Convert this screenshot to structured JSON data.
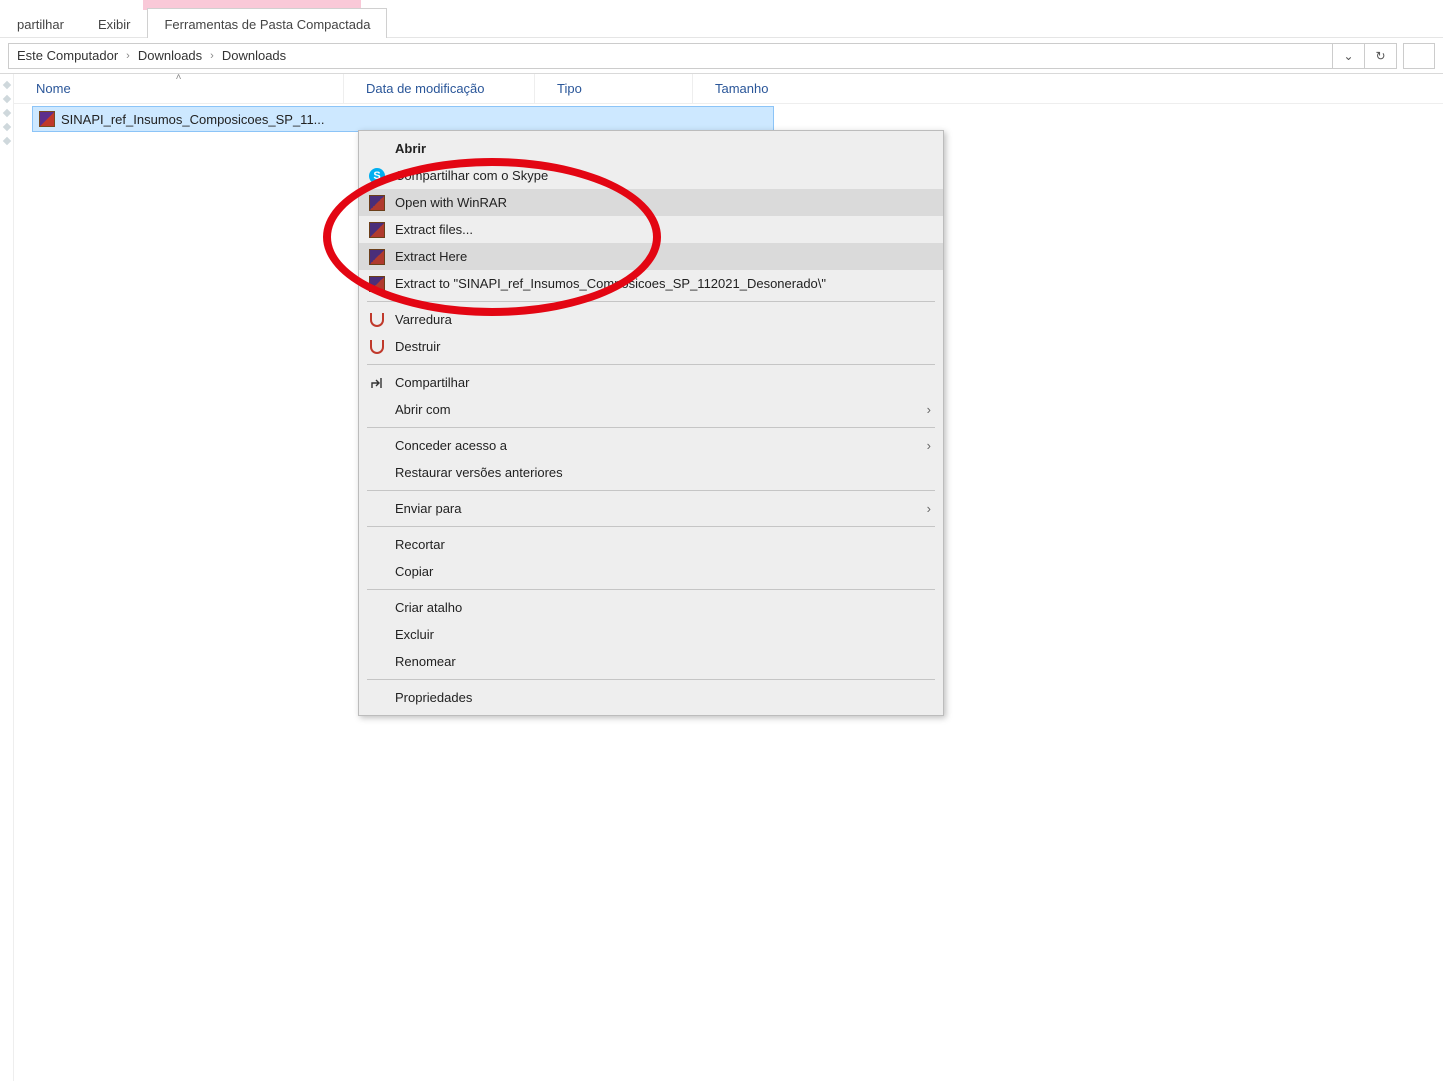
{
  "ribbon": {
    "tabs": [
      "partilhar",
      "Exibir",
      "Ferramentas de Pasta Compactada"
    ]
  },
  "breadcrumb": {
    "segments": [
      "Este Computador",
      "Downloads",
      "Downloads"
    ]
  },
  "columns": {
    "name": "Nome",
    "modified": "Data de modificação",
    "type": "Tipo",
    "size": "Tamanho"
  },
  "file": {
    "name": "SINAPI_ref_Insumos_Composicoes_SP_11..."
  },
  "context_menu": {
    "items": [
      {
        "label": "Abrir",
        "bold": true,
        "icon": "none"
      },
      {
        "label": "Compartilhar com o Skype",
        "icon": "skype"
      },
      {
        "label": "Open with WinRAR",
        "icon": "rar",
        "hovered": true
      },
      {
        "label": "Extract files...",
        "icon": "rar"
      },
      {
        "label": "Extract Here",
        "icon": "rar",
        "hovered": true
      },
      {
        "label": "Extract to \"SINAPI_ref_Insumos_Composicoes_SP_112021_Desonerado\\\"",
        "icon": "rar"
      },
      {
        "sep": true
      },
      {
        "label": "Varredura",
        "icon": "shield"
      },
      {
        "label": "Destruir",
        "icon": "shield"
      },
      {
        "sep": true
      },
      {
        "label": "Compartilhar",
        "icon": "share"
      },
      {
        "label": "Abrir com",
        "icon": "none",
        "submenu": true
      },
      {
        "sep": true
      },
      {
        "label": "Conceder acesso a",
        "icon": "none",
        "submenu": true
      },
      {
        "label": "Restaurar versões anteriores",
        "icon": "none"
      },
      {
        "sep": true
      },
      {
        "label": "Enviar para",
        "icon": "none",
        "submenu": true
      },
      {
        "sep": true
      },
      {
        "label": "Recortar",
        "icon": "none"
      },
      {
        "label": "Copiar",
        "icon": "none"
      },
      {
        "sep": true
      },
      {
        "label": "Criar atalho",
        "icon": "none"
      },
      {
        "label": "Excluir",
        "icon": "none"
      },
      {
        "label": "Renomear",
        "icon": "none"
      },
      {
        "sep": true
      },
      {
        "label": "Propriedades",
        "icon": "none"
      }
    ]
  }
}
